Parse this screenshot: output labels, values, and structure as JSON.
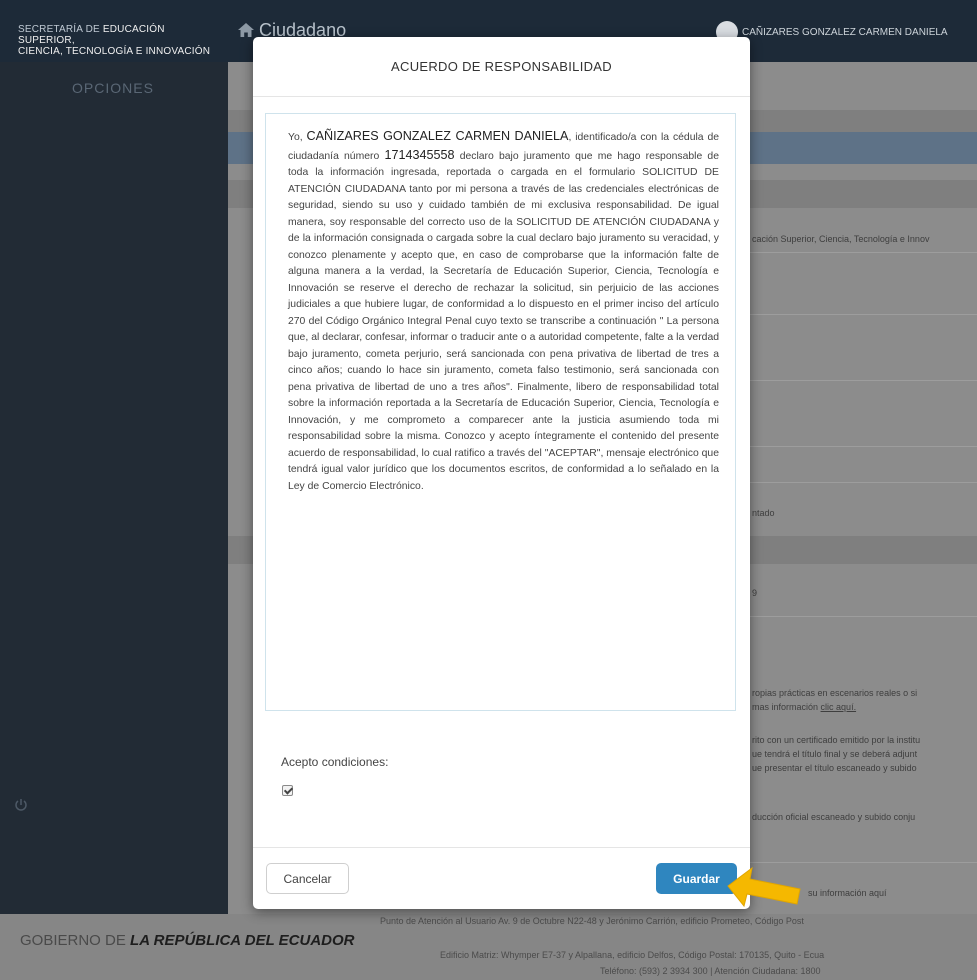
{
  "header": {
    "brand_prefix": "SECRETARÍA DE",
    "brand_line1": "EDUCACIÓN SUPERIOR,",
    "brand_line2": "CIENCIA, TECNOLOGÍA E INNOVACIÓN",
    "app_title": "Ciudadano",
    "user_name": "CAÑIZARES GONZALEZ CARMEN DANIELA"
  },
  "sidebar": {
    "title": "OPCIONES"
  },
  "background_snippets": {
    "institution": "cación Superior, Ciencia, Tecnología e Innov",
    "status": "ntado",
    "digit": "9",
    "info_line1": "ropias prácticas en escenarios reales o si",
    "info_line2": "mas información",
    "info_link": "clic aquí.",
    "cert_line1": "rito con un certificado emitido por la institu",
    "cert_line2": "ue tendrá el título final y se deberá adjunt",
    "cert_line3": "ue presentar el título escaneado y subido",
    "scan_line": "ducción oficial escaneado y subido conju",
    "more_info": "su información aquí",
    "footer_line1": "Punto de Atención al Usuario Av. 9 de Octubre N22-48 y Jerónimo Carrión, edificio Prometeo, Código Post",
    "footer_line2": "Edificio Matriz: Whymper E7-37 y Alpallana, edificio Delfos, Código Postal: 170135, Quito - Ecua",
    "footer_line3": "Teléfono: (593) 2 3934 300 | Atención Ciudadana: 1800"
  },
  "footer": {
    "gov_prefix": "GOBIERNO DE",
    "gov_name": "LA REPÚBLICA DEL ECUADOR"
  },
  "modal": {
    "title": "ACUERDO DE RESPONSABILIDAD",
    "text_start": "Yo,",
    "name": "CAÑIZARES GONZALEZ CARMEN DANIELA",
    "text_id": ", identificado/a con la cédula de ciudadanía número",
    "id_number": "1714345558",
    "text_body": "declaro bajo juramento que me hago responsable de toda la información ingresada, reportada o cargada en el formulario SOLICITUD DE ATENCIÓN CIUDADANA tanto por mi persona a través de las credenciales electrónicas de seguridad, siendo su uso y cuidado también de mi exclusiva responsabilidad. De igual manera, soy responsable del correcto uso de la SOLICITUD DE ATENCIÓN CIUDADANA y de la información consignada o cargada sobre la cual declaro bajo juramento su veracidad, y conozco plenamente y acepto que, en caso de comprobarse que la información falte de alguna manera a la verdad, la Secretaría de Educación Superior, Ciencia, Tecnología e Innovación se reserve el derecho de rechazar la solicitud, sin perjuicio de las acciones judiciales a que hubiere lugar, de conformidad a lo dispuesto en el primer inciso del artículo 270 del Código Orgánico Integral Penal cuyo texto se transcribe a continuación \" La persona que, al declarar, confesar, informar o traducir ante o a autoridad competente, falte a la verdad bajo juramento, cometa perjurio, será sancionada con pena privativa de libertad de tres a cinco años; cuando lo hace sin juramento, cometa falso testimonio, será sancionada con pena privativa de libertad de uno a tres años\". Finalmente, libero de responsabilidad total sobre la información reportada a la Secretaría de Educación Superior, Ciencia, Tecnología e Innovación, y me comprometo a comparecer ante la justicia asumiendo toda mi responsabilidad sobre la misma. Conozco y acepto íntegramente el contenido del presente acuerdo de responsabilidad, lo cual ratifico a través del \"ACEPTAR\", mensaje electrónico que tendrá igual valor jurídico que los documentos escritos, de conformidad a lo señalado en la Ley de Comercio Electrónico.",
    "accept_label": "Acepto condiciones:",
    "cancel_label": "Cancelar",
    "save_label": "Guardar"
  },
  "colors": {
    "topbar": "#1d2a38",
    "sidebar": "#222b35",
    "primary_button": "#2f86bf",
    "arrow": "#f5b800"
  }
}
